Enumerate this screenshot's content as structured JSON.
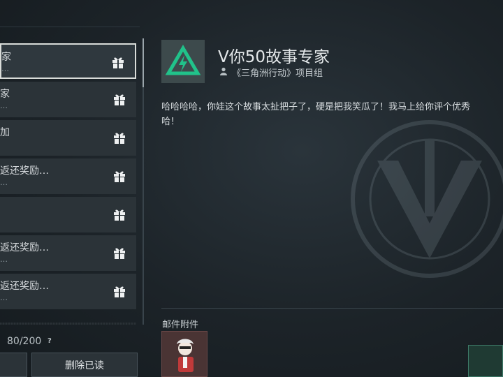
{
  "mail_list": {
    "items": [
      {
        "title": "家",
        "subtitle": "…",
        "selected": true,
        "icon": "gift-icon"
      },
      {
        "title": "家",
        "subtitle": "…",
        "selected": false,
        "icon": "gift-icon"
      },
      {
        "title": "加",
        "subtitle": "",
        "selected": false,
        "icon": "gift-icon"
      },
      {
        "title": "返还奖励…",
        "subtitle": "…",
        "selected": false,
        "icon": "gift-icon"
      },
      {
        "title": "",
        "subtitle": "",
        "selected": false,
        "icon": "gift-icon"
      },
      {
        "title": "返还奖励…",
        "subtitle": "…",
        "selected": false,
        "icon": "gift-icon"
      },
      {
        "title": "返还奖励…",
        "subtitle": "…",
        "selected": false,
        "icon": "gift-icon"
      }
    ],
    "count": "80/200",
    "help": "?"
  },
  "buttons": {
    "left_label": "",
    "delete_read_label": "删除已读"
  },
  "detail": {
    "title": "V你50故事专家",
    "sender": "《三角洲行动》项目组",
    "body": "哈哈哈哈，你娃这个故事太扯把子了，硬是把我笑瓜了！我马上给你评个优秀\n哈！",
    "attachments_label": "邮件附件",
    "logo_color": "#21c28a",
    "attachment_icon": "character-figure-icon"
  }
}
